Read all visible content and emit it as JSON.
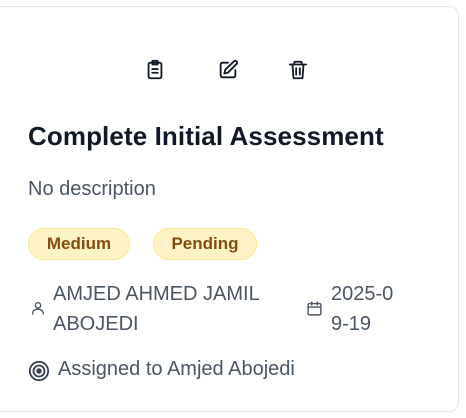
{
  "task": {
    "title": "Complete Initial Assessment",
    "description": "No description",
    "priority": "Medium",
    "status": "Pending",
    "owner": "AMJED AHMED JAMIL ABOJEDI",
    "due_date": "2025-09-19",
    "assigned": "Assigned to Amjed Abojedi"
  },
  "actions": [
    {
      "name": "view",
      "icon": "clipboard-icon"
    },
    {
      "name": "edit",
      "icon": "edit-icon"
    },
    {
      "name": "delete",
      "icon": "trash-icon"
    }
  ],
  "colors": {
    "badge_background": "#fef3c7",
    "badge_border": "#fde68a",
    "badge_text": "#854d0e",
    "title_text": "#111827",
    "muted_text": "#4b5563"
  }
}
